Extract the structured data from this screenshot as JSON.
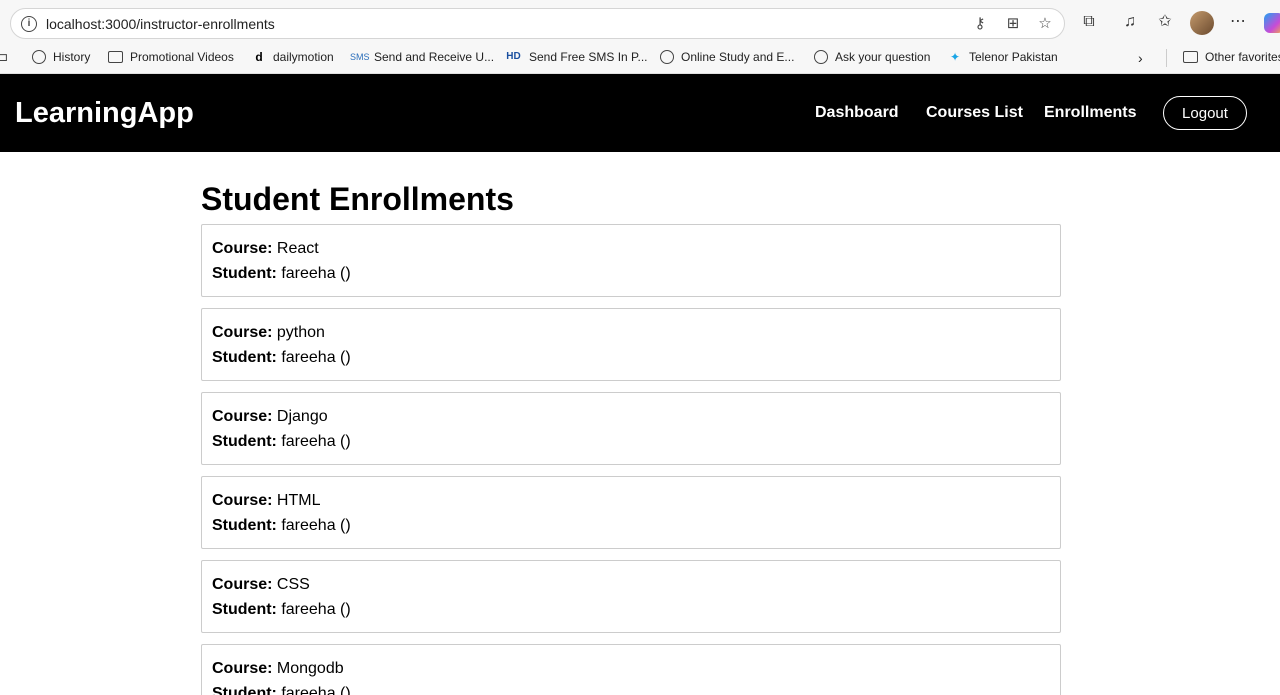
{
  "browser": {
    "url": "localhost:3000/instructor-enrollments",
    "bookmarks": [
      {
        "label": "History",
        "icon": "globe-icon"
      },
      {
        "label": "Promotional Videos",
        "icon": "folder-icon"
      },
      {
        "label": "dailymotion",
        "icon": "dailymotion-icon"
      },
      {
        "label": "Send and Receive U...",
        "icon": "sms-icon"
      },
      {
        "label": "Send Free SMS In P...",
        "icon": "hd-icon"
      },
      {
        "label": "Online Study and E...",
        "icon": "globe-icon"
      },
      {
        "label": "Ask your question",
        "icon": "globe-icon"
      },
      {
        "label": "Telenor Pakistan",
        "icon": "telenor-icon"
      }
    ],
    "other_favorites": "Other favorites"
  },
  "navbar": {
    "brand": "LearningApp",
    "links": [
      "Dashboard",
      "Courses List",
      "Enrollments"
    ],
    "logout": "Logout"
  },
  "page": {
    "title": "Student Enrollments",
    "course_label": "Course:",
    "student_label": "Student:",
    "enrollments": [
      {
        "course": "React",
        "student": "fareeha ()"
      },
      {
        "course": "python",
        "student": "fareeha ()"
      },
      {
        "course": "Django",
        "student": "fareeha ()"
      },
      {
        "course": "HTML",
        "student": "fareeha ()"
      },
      {
        "course": "CSS",
        "student": "fareeha ()"
      },
      {
        "course": "Mongodb",
        "student": "fareeha ()"
      }
    ]
  },
  "colors": {
    "navbar_bg": "#000000",
    "navbar_text": "#ffffff",
    "card_border": "#cccccc"
  }
}
